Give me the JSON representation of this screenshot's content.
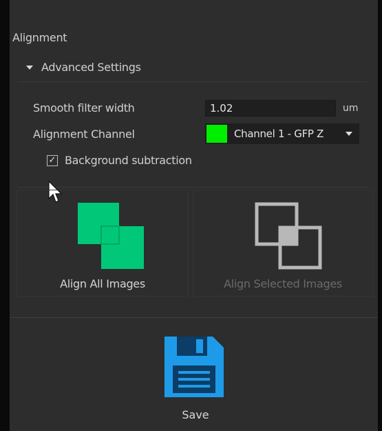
{
  "section": {
    "title": "Alignment"
  },
  "advanced": {
    "header_label": "Advanced Settings",
    "smooth_filter": {
      "label": "Smooth filter width",
      "value": "1.02",
      "unit": "um"
    },
    "alignment_channel": {
      "label": "Alignment Channel",
      "selected": "Channel 1 - GFP Z",
      "swatch_color": "#00ee00"
    },
    "background_subtraction": {
      "label": "Background subtraction",
      "checked": true
    }
  },
  "actions": {
    "align_all": {
      "label": "Align All Images",
      "icon": "align-all-icon",
      "color": "#00c878"
    },
    "align_selected": {
      "label": "Align Selected Images",
      "icon": "align-selected-icon",
      "enabled": false
    }
  },
  "save": {
    "label": "Save",
    "icon": "floppy-disk-icon",
    "color": "#1e9be8"
  }
}
